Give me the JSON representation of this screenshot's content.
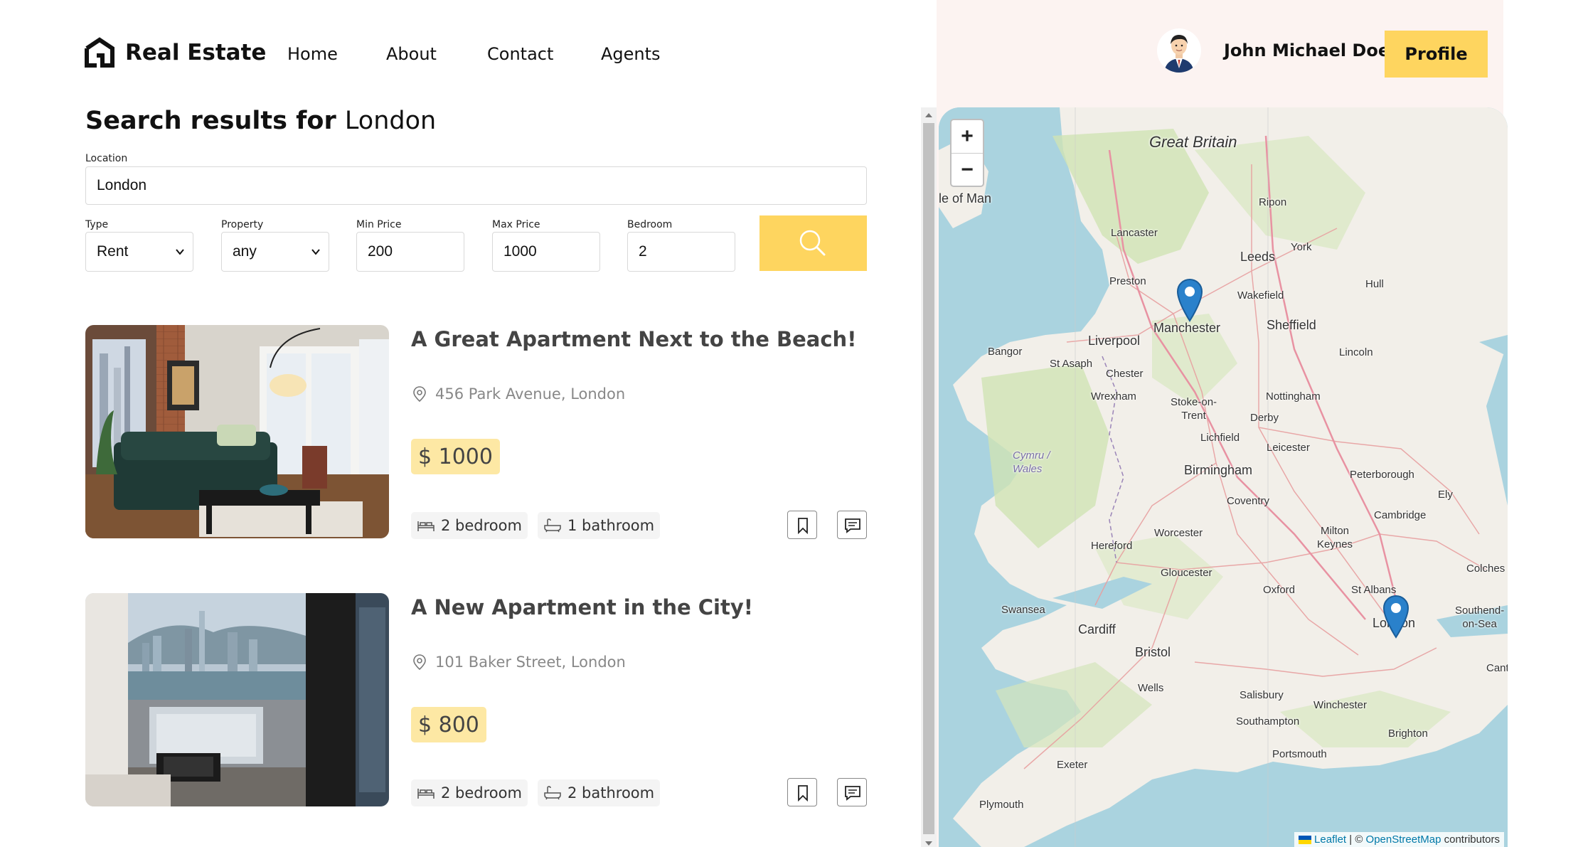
{
  "nav": {
    "brand": "Real Estate",
    "links": [
      "Home",
      "About",
      "Contact",
      "Agents"
    ],
    "user_name": "John Michael Doe",
    "profile_label": "Profile"
  },
  "search": {
    "title_prefix": "Search results for",
    "title_query": "London",
    "location_label": "Location",
    "location_value": "London",
    "type_label": "Type",
    "type_value": "Rent",
    "property_label": "Property",
    "property_value": "any",
    "min_price_label": "Min Price",
    "min_price_value": "200",
    "max_price_label": "Max Price",
    "max_price_value": "1000",
    "bedroom_label": "Bedroom",
    "bedroom_value": "2"
  },
  "listings": [
    {
      "title": "A Great Apartment Next to the Beach!",
      "address": "456 Park Avenue, London",
      "price": "$ 1000",
      "bedrooms": "2 bedroom",
      "bathrooms": "1 bathroom"
    },
    {
      "title": "A New Apartment in the City!",
      "address": "101 Baker Street, London",
      "price": "$ 800",
      "bedrooms": "2 bedroom",
      "bathrooms": "2 bathroom"
    }
  ],
  "map": {
    "zoom_in": "+",
    "zoom_out": "−",
    "places": {
      "great_britain": "Great Britain",
      "isle_of_man": "le of Man",
      "ripon": "Ripon",
      "lancaster": "Lancaster",
      "leeds": "Leeds",
      "york": "York",
      "preston": "Preston",
      "wakefield": "Wakefield",
      "hull": "Hull",
      "manchester": "Manchester",
      "sheffield": "Sheffield",
      "liverpool": "Liverpool",
      "bangor": "Bangor",
      "st_asaph": "St Asaph",
      "lincoln": "Lincoln",
      "chester": "Chester",
      "wrexham": "Wrexham",
      "stoke": "Stoke-on-\nTrent",
      "nottingham": "Nottingham",
      "derby": "Derby",
      "lichfield": "Lichfield",
      "leicester": "Leicester",
      "wales": "Cymru /\nWales",
      "birmingham": "Birmingham",
      "peterborough": "Peterborough",
      "coventry": "Coventry",
      "ely": "Ely",
      "cambridge": "Cambridge",
      "worcester": "Worcester",
      "milton_keynes": "Milton\nKeynes",
      "hereford": "Hereford",
      "colchester": "Colches",
      "gloucester": "Gloucester",
      "st_albans": "St Albans",
      "oxford": "Oxford",
      "swansea": "Swansea",
      "southend": "Southend-\non-Sea",
      "cardiff": "Cardiff",
      "london": "London",
      "bristol": "Bristol",
      "canterbury": "Cant",
      "wells": "Wells",
      "salisbury": "Salisbury",
      "winchester": "Winchester",
      "southampton": "Southampton",
      "brighton": "Brighton",
      "portsmouth": "Portsmouth",
      "exeter": "Exeter",
      "plymouth": "Plymouth"
    },
    "attribution_leaflet": "Leaflet",
    "attribution_sep": " | © ",
    "attribution_osm": "OpenStreetMap",
    "attribution_rest": " contributors"
  },
  "colors": {
    "accent": "#fed55f",
    "price_bg": "#fde8a4",
    "side_bg": "#fcf3f1",
    "water": "#aad3df",
    "land": "#f2efe9",
    "marker": "#2a81cb"
  }
}
